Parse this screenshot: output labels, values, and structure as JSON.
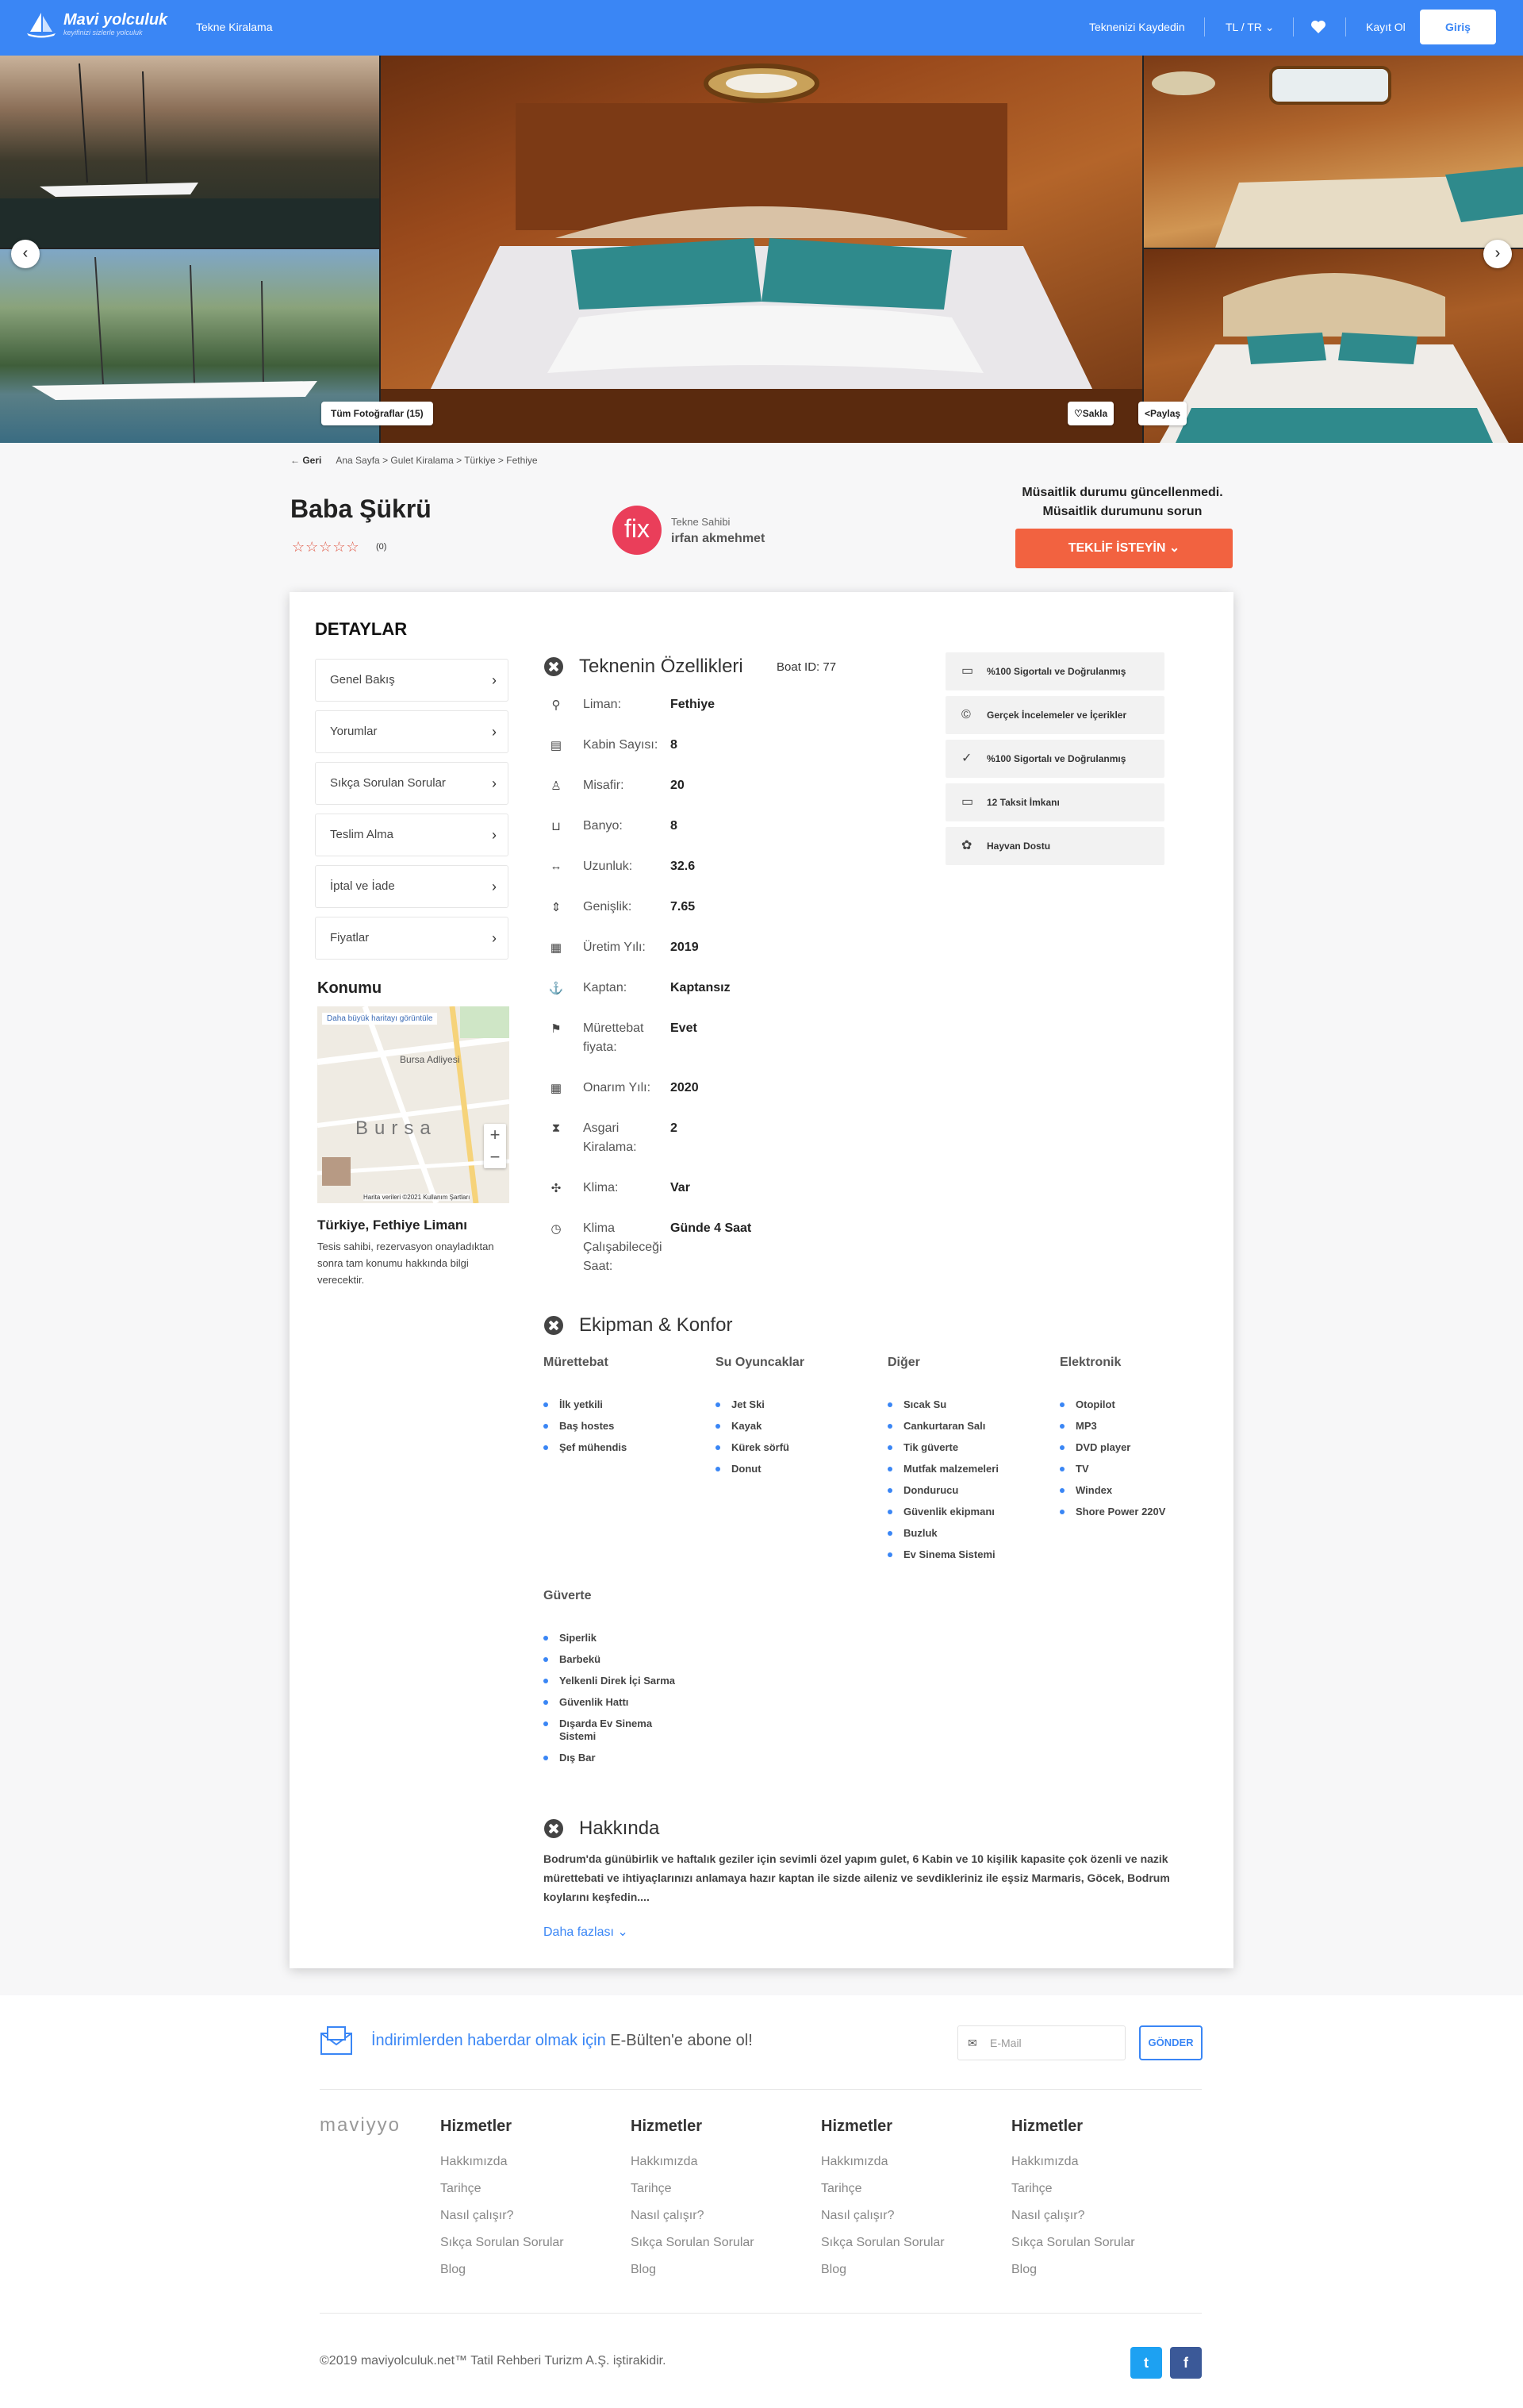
{
  "header": {
    "logo_title": "Mavi yolculuk",
    "logo_sub": "keyifinizi sizlerle yolculuk",
    "nav_item": "Tekne Kiralama",
    "register_boat": "Teknenizi Kaydedin",
    "currency_lang": "TL / TR",
    "signup": "Kayıt Ol",
    "login": "Giriş"
  },
  "gallery": {
    "all_photos": "Tüm Fotoğraflar (15)",
    "save": "Sakla",
    "share": "Paylaş"
  },
  "breadcrumb": {
    "back": "Geri",
    "path": "Ana Sayfa > Gulet Kiralama > Türkiye > Fethiye"
  },
  "listing": {
    "title": "Baba Şükrü",
    "rating_count": "(0)",
    "owner_logo": "fix",
    "owner_label": "Tekne Sahibi",
    "owner_name": "irfan akmehmet",
    "availability_1": "Müsaitlik durumu güncellenmedi.",
    "availability_2": "Müsaitlik durumunu sorun",
    "offer_button": "TEKLİF İSTEYİN"
  },
  "details": {
    "title": "DETAYLAR",
    "menu": [
      "Genel Bakış",
      "Yorumlar",
      "Sıkça Sorulan Sorular",
      "Teslim Alma",
      "İptal ve İade",
      "Fiyatlar"
    ],
    "location_title": "Konumu",
    "map_link": "Daha büyük haritayı görüntüle",
    "map_city": "Bursa",
    "map_poi": "Bursa Adliyesi",
    "map_attribution": "Harita verileri ©2021   Kullanım Şartları",
    "location_name": "Türkiye, Fethiye Limanı",
    "location_desc": "Tesis sahibi, rezervasyon onayladıktan sonra tam konumu hakkında bilgi verecektir."
  },
  "features": {
    "title": "Teknenin Özellikleri",
    "boat_id_label": "Boat ID:",
    "boat_id": "77",
    "items": [
      {
        "icon": "location-pin-icon",
        "label": "Liman:",
        "value": "Fethiye"
      },
      {
        "icon": "cabin-icon",
        "label": "Kabin Sayısı:",
        "value": "8"
      },
      {
        "icon": "guest-icon",
        "label": "Misafir:",
        "value": "20"
      },
      {
        "icon": "bath-icon",
        "label": "Banyo:",
        "value": "8"
      },
      {
        "icon": "length-icon",
        "label": "Uzunluk:",
        "value": "32.6"
      },
      {
        "icon": "width-icon",
        "label": "Genişlik:",
        "value": "7.65"
      },
      {
        "icon": "calendar-icon",
        "label": "Üretim Yılı:",
        "value": "2019"
      },
      {
        "icon": "captain-icon",
        "label": "Kaptan:",
        "value": "Kaptansız"
      },
      {
        "icon": "crew-icon",
        "label": "Mürettebat fiyata:",
        "value": "Evet"
      },
      {
        "icon": "calendar-icon",
        "label": "Onarım Yılı:",
        "value": "2020"
      },
      {
        "icon": "hourglass-icon",
        "label": "Asgari Kiralama:",
        "value": "2"
      },
      {
        "icon": "ac-icon",
        "label": "Klima:",
        "value": "Var"
      },
      {
        "icon": "clock-icon",
        "label": "Klima Çalışabileceği Saat:",
        "value": "Günde 4 Saat"
      }
    ],
    "badges": [
      {
        "icon": "card-icon",
        "text": "%100 Sigortalı ve Doğrulanmış"
      },
      {
        "icon": "copyright-icon",
        "text": "Gerçek İncelemeler ve İçerikler"
      },
      {
        "icon": "check-icon",
        "text": "%100 Sigortalı ve Doğrulanmış"
      },
      {
        "icon": "card-icon",
        "text": "12 Taksit İmkanı"
      },
      {
        "icon": "paw-icon",
        "text": "Hayvan Dostu"
      }
    ]
  },
  "equipment": {
    "title": "Ekipman & Konfor",
    "columns": [
      {
        "head": "Mürettebat",
        "items": [
          "İlk yetkili",
          "Baş hostes",
          "Şef mühendis"
        ]
      },
      {
        "head": "Su Oyuncaklar",
        "items": [
          "Jet Ski",
          "Kayak",
          "Kürek sörfü",
          "Donut"
        ]
      },
      {
        "head": "Diğer",
        "items": [
          "Sıcak Su",
          "Cankurtaran Salı",
          "Tik güverte",
          "Mutfak malzemeleri",
          "Dondurucu",
          "Güvenlik ekipmanı",
          "Buzluk",
          "Ev Sinema Sistemi"
        ]
      },
      {
        "head": "Elektronik",
        "items": [
          "Otopilot",
          "MP3",
          "DVD player",
          "TV",
          "Windex",
          "Shore Power 220V"
        ]
      },
      {
        "head": "Güverte",
        "items": [
          "Siperlik",
          "Barbekü",
          "Yelkenli Direk İçi Sarma",
          "Güvenlik Hattı",
          "Dışarda Ev Sinema Sistemi",
          "Dış Bar"
        ]
      }
    ]
  },
  "about": {
    "title": "Hakkında",
    "text": "Bodrum'da günübirlik ve haftalık geziler için sevimli özel yapım gulet, 6 Kabin ve 10 kişilik kapasite çok özenli ve nazik mürettebati ve ihtiyaçlarınızı anlamaya hazır kaptan ile sizde aileniz ve sevdikleriniz ile eşsiz Marmaris, Göcek, Bodrum koylarını keşfedin....",
    "more": "Daha fazlası"
  },
  "footer": {
    "newsletter_1": "İndirimlerden haberdar olmak için ",
    "newsletter_2": "E-Bülten'e abone ol!",
    "email_placeholder": "E-Mail",
    "send": "GÖNDER",
    "brand": "maviyyo",
    "columns": [
      {
        "head": "Hizmetler",
        "links": [
          "Hakkımızda",
          "Tarihçe",
          "Nasıl çalışır?",
          "Sıkça Sorulan Sorular",
          "Blog"
        ]
      },
      {
        "head": "Hizmetler",
        "links": [
          "Hakkımızda",
          "Tarihçe",
          "Nasıl çalışır?",
          "Sıkça Sorulan Sorular",
          "Blog"
        ]
      },
      {
        "head": "Hizmetler",
        "links": [
          "Hakkımızda",
          "Tarihçe",
          "Nasıl çalışır?",
          "Sıkça Sorulan Sorular",
          "Blog"
        ]
      },
      {
        "head": "Hizmetler",
        "links": [
          "Hakkımızda",
          "Tarihçe",
          "Nasıl çalışır?",
          "Sıkça Sorulan Sorular",
          "Blog"
        ]
      }
    ],
    "copyright": "©2019 maviyolculuk.net™ Tatil Rehberi Turizm A.Ş. iştirakidir.",
    "twitter_color": "#1da1f2",
    "facebook_color": "#3b5998"
  }
}
